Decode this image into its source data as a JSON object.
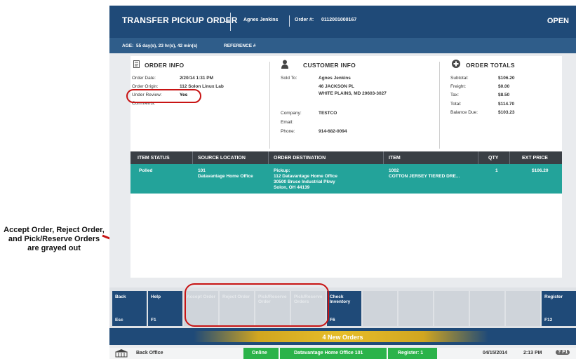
{
  "header": {
    "title": "TRANSFER PICKUP ORDER",
    "customer": "Agnes Jenkins",
    "order_label": "Order #:",
    "order_number": "0112001000167",
    "status": "OPEN"
  },
  "age_bar": {
    "age_label": "AGE:",
    "age_value": "55 day(s), 23 hr(s), 42 min(s)",
    "reference_label": "REFERENCE #"
  },
  "order_info": {
    "heading": "ORDER INFO",
    "fields": [
      {
        "label": "Order Date:",
        "value": "2/20/14 1:31 PM"
      },
      {
        "label": "Order Origin:",
        "value": "112 Solon Linux Lab"
      },
      {
        "label": "Under Review:",
        "value": "Yes"
      },
      {
        "label": "Comments:",
        "value": ""
      }
    ]
  },
  "customer_info": {
    "heading": "CUSTOMER INFO",
    "sold_to_label": "Sold To:",
    "sold_to_lines": [
      "Agnes Jenkins",
      "46 JACKSON PL",
      "WHITE PLAINS, MD 20603-3027"
    ],
    "company_label": "Company:",
    "company": "TESTCO",
    "email_label": "Email:",
    "email": "",
    "phone_label": "Phone:",
    "phone": "914-682-0094"
  },
  "order_totals": {
    "heading": "ORDER TOTALS",
    "rows": [
      {
        "label": "Subtotal:",
        "value": "$106.20"
      },
      {
        "label": "Freight:",
        "value": "$0.00"
      },
      {
        "label": "Tax:",
        "value": "$8.50"
      },
      {
        "label": "Total:",
        "value": "$114.70"
      },
      {
        "label": "Balance Due:",
        "value": "$103.23"
      }
    ]
  },
  "table": {
    "columns": [
      "ITEM STATUS",
      "SOURCE LOCATION",
      "ORDER DESTINATION",
      "ITEM",
      "QTY",
      "EXT PRICE"
    ],
    "row": {
      "status": "Polled",
      "source": [
        "101",
        "Datavantage Home Office"
      ],
      "destination": [
        "Pickup:",
        "112 Datavantage Home Office",
        "30500 Bruce Industrial Pkwy",
        "Solon, OH 44139"
      ],
      "item": [
        "1002",
        "COTTON JERSEY TIERED DRE..."
      ],
      "qty": "1",
      "ext_price": "$106.20"
    }
  },
  "function_keys": [
    {
      "label": "Back",
      "key": "Esc"
    },
    {
      "label": "Help",
      "key": "F1"
    },
    {
      "label": "Accept Order",
      "key": ""
    },
    {
      "label": "Reject Order",
      "key": ""
    },
    {
      "label": "Pick/Reserve Order",
      "key": ""
    },
    {
      "label": "Pick/Reserve Orders",
      "key": ""
    },
    {
      "label": "Check Inventory",
      "key": "F6"
    },
    {
      "label": "",
      "key": ""
    },
    {
      "label": "",
      "key": ""
    },
    {
      "label": "",
      "key": ""
    },
    {
      "label": "",
      "key": ""
    },
    {
      "label": "",
      "key": ""
    },
    {
      "label": "Register",
      "key": "F12"
    }
  ],
  "new_orders": "4 New Orders",
  "status_bar": {
    "back_office": "Back Office",
    "online": "Online",
    "location": "Datavantage Home Office 101",
    "register": "Register: 1",
    "date": "04/15/2014",
    "time": "2:13 PM",
    "help": "? F1"
  },
  "annotation": "Accept Order, Reject Order, and Pick/Reserve Orders are grayed out",
  "colors": {
    "header_blue": "#1f4a78",
    "row_teal": "#23a39a",
    "online_green": "#2bb34a",
    "highlight_red": "#c81414",
    "banner_gold": "#e6bd2a"
  }
}
